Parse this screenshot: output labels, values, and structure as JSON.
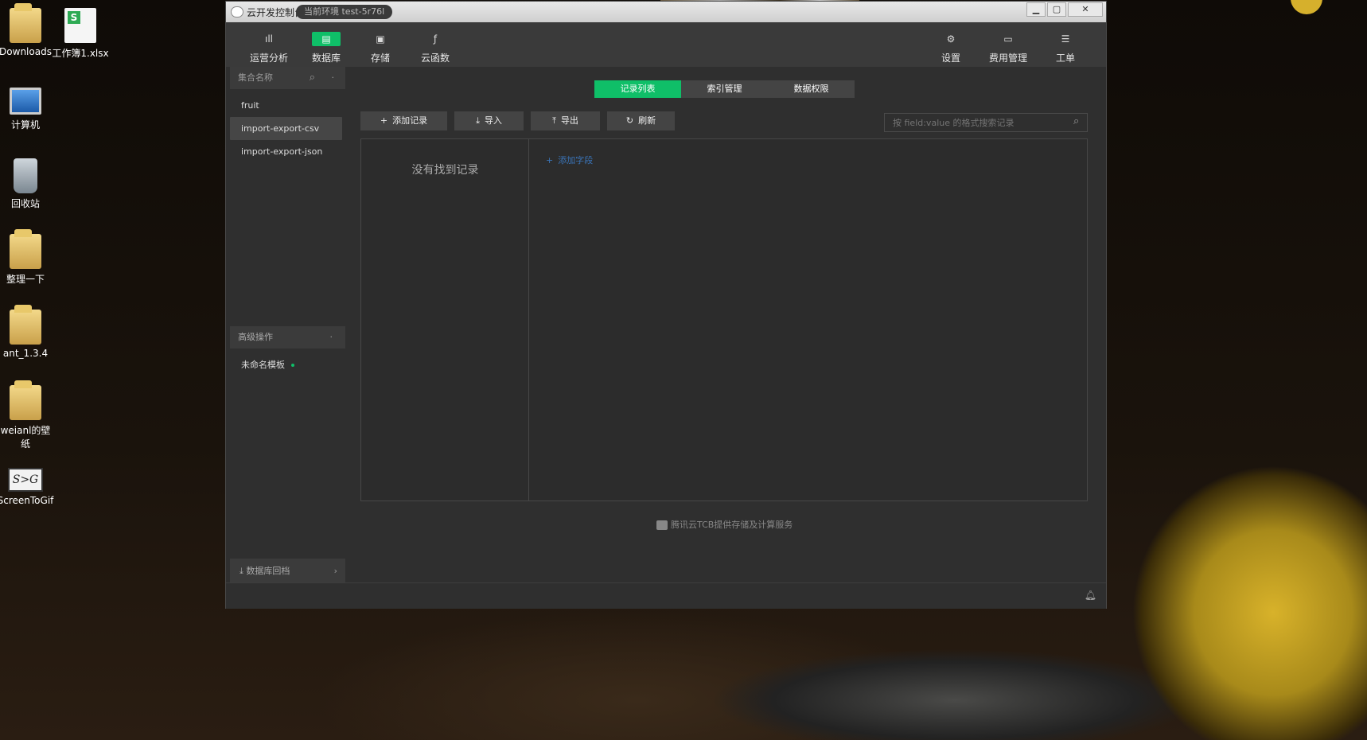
{
  "desktop": {
    "icons": [
      {
        "label": "Downloads",
        "type": "folder"
      },
      {
        "label": "工作簿1.xlsx",
        "type": "sheet"
      },
      {
        "label": "计算机",
        "type": "pc"
      },
      {
        "label": "回收站",
        "type": "bin"
      },
      {
        "label": "整理一下",
        "type": "folder"
      },
      {
        "label": "ant_1.3.4",
        "type": "folder"
      },
      {
        "label": "weianl的壁纸",
        "type": "folder"
      },
      {
        "label": "ScreenToGif",
        "type": "s2g"
      }
    ]
  },
  "window": {
    "title": "云开发控制台",
    "env_label": "当前环境 test-5r76l",
    "controls": {
      "minimize": "▁",
      "maximize": "▢",
      "close": "✕"
    }
  },
  "topnav": {
    "left": [
      {
        "label": "运营分析",
        "icon": "chart-bars-icon",
        "glyph": "ıll"
      },
      {
        "label": "数据库",
        "icon": "database-icon",
        "glyph": "▤"
      },
      {
        "label": "存储",
        "icon": "storage-icon",
        "glyph": "▣"
      },
      {
        "label": "云函数",
        "icon": "cloud-function-icon",
        "glyph": "ƒ"
      }
    ],
    "right": [
      {
        "label": "设置",
        "icon": "gear-icon",
        "glyph": "⚙"
      },
      {
        "label": "费用管理",
        "icon": "billing-icon",
        "glyph": "▭"
      },
      {
        "label": "工单",
        "icon": "ticket-icon",
        "glyph": "☰"
      }
    ],
    "active": "数据库"
  },
  "sidebar": {
    "collection_header": "集合名称",
    "collections": [
      "fruit",
      "import-export-csv",
      "import-export-json"
    ],
    "active_collection": "import-export-csv",
    "advanced_header": "高级操作",
    "template_item": "未命名模板",
    "rollback_label": "数据库回档"
  },
  "main": {
    "tabs": [
      "记录列表",
      "索引管理",
      "数据权限"
    ],
    "active_tab": "记录列表",
    "toolbar": {
      "add_record": "添加记录",
      "import": "导入",
      "export": "导出",
      "refresh": "刷新"
    },
    "search_placeholder": "按 field:value 的格式搜索记录",
    "empty_text": "没有找到记录",
    "add_field": "添加字段"
  },
  "footer": {
    "credit": "腾讯云TCB提供存储及计算服务"
  },
  "colors": {
    "accent": "#0fbf68",
    "link": "#3a74b8",
    "panel": "#2f2f2f"
  }
}
